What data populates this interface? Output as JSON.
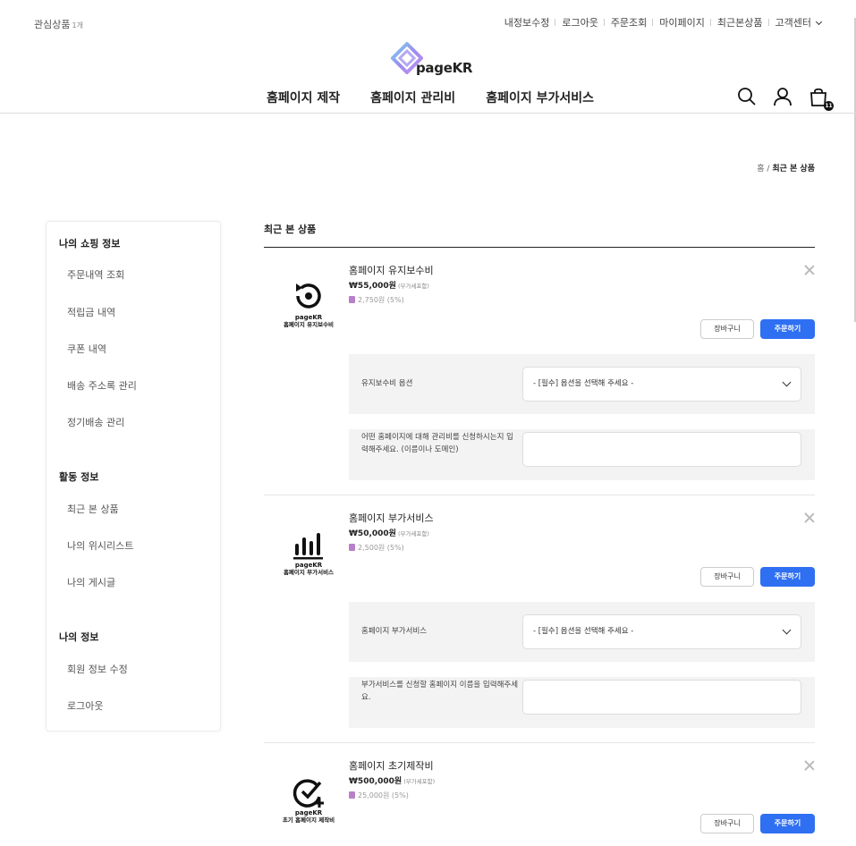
{
  "topbar": {
    "wishlist_label": "관심상품",
    "wishlist_count": "1개",
    "links": [
      "내정보수정",
      "로그아웃",
      "주문조회",
      "마이페이지",
      "최근본상품",
      "고객센터"
    ]
  },
  "logo": {
    "text": "pageKR"
  },
  "gnb": [
    "홈페이지 제작",
    "홈페이지 관리비",
    "홈페이지 부가서비스"
  ],
  "header_icons": {
    "search": "search-icon",
    "user": "user-icon",
    "cart": "cart-icon",
    "cart_count": "11"
  },
  "breadcrumb": {
    "home": "홈",
    "separator": "/",
    "current": "최근 본 상품"
  },
  "sidebar": {
    "sections": [
      {
        "title": "나의 쇼핑 정보",
        "items": [
          "주문내역 조회",
          "적립금 내역",
          "쿠폰 내역",
          "배송 주소록 관리",
          "정기배송 관리"
        ]
      },
      {
        "title": "활동 정보",
        "items": [
          "최근 본 상품",
          "나의 위시리스트",
          "나의 게시글"
        ]
      },
      {
        "title": "나의 정보",
        "items": [
          "회원 정보 수정",
          "로그아웃"
        ]
      }
    ]
  },
  "main": {
    "title": "최근 본 상품",
    "buttons": {
      "cart": "장바구니",
      "order": "주문하기"
    },
    "products": [
      {
        "thumb_brand": "pageKR",
        "thumb_caption": "홈페이지 유지보수비",
        "icon": "maintenance-icon",
        "name": "홈페이지 유지보수비",
        "price": "₩55,000원",
        "vat": "(부가세포함)",
        "point": "2,750원 (5%)",
        "option_label": "유지보수비 옵션",
        "option_value": "- [필수] 옵션을 선택해 주세요 -",
        "input_label": "어떤 홈페이지에 대해 관리비를 신청하시는지 입력해주세요. (이름이나 도메인)"
      },
      {
        "thumb_brand": "pageKR",
        "thumb_caption": "홈페이지 부가서비스",
        "icon": "bar-chart-icon",
        "name": "홈페이지 부가서비스",
        "price": "₩50,000원",
        "vat": "(부가세포함)",
        "point": "2,500원 (5%)",
        "option_label": "홈페이지 부가서비스",
        "option_value": "- [필수] 옵션을 선택해 주세요 -",
        "input_label": "부가서비스를 신청할 홈페이지 이름을 입력해주세요."
      },
      {
        "thumb_brand": "pageKR",
        "thumb_caption": "초기 홈페이지 제작비",
        "icon": "check-plus-icon",
        "name": "홈페이지 초기제작비",
        "price": "₩500,000원",
        "vat": "(부가세포함)",
        "point": "25,000원 (5%)"
      }
    ]
  }
}
